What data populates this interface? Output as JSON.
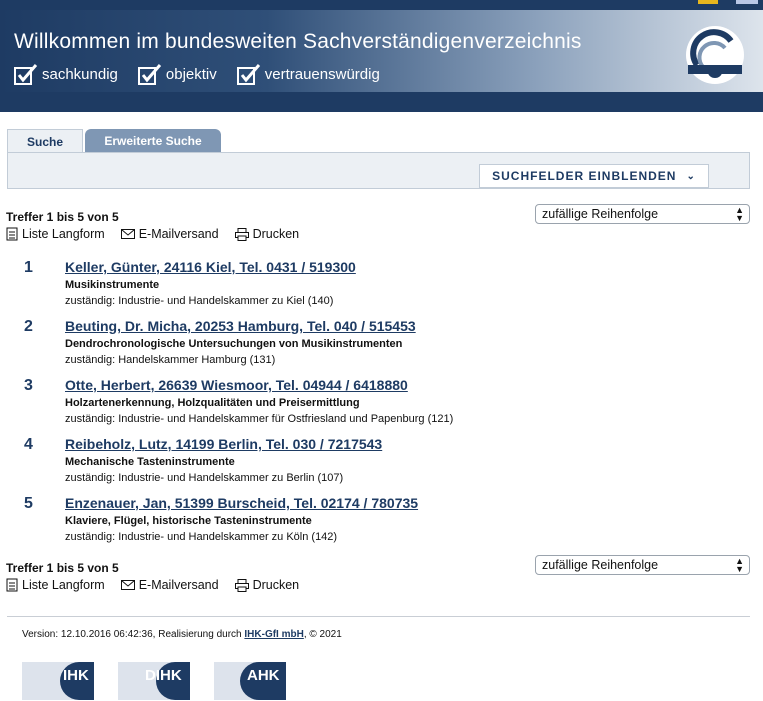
{
  "header": {
    "welcome": "Willkommen im bundesweiten Sachverständigenverzeichnis",
    "claims": [
      "sachkundig",
      "objektiv",
      "vertrauenswürdig"
    ]
  },
  "tabs": [
    {
      "label": "Suche",
      "active": true
    },
    {
      "label": "Erweiterte Suche",
      "active": false
    }
  ],
  "search": {
    "toggle_label": "SUCHFELDER EINBLENDEN"
  },
  "results_top": {
    "count_text": "Treffer 1 bis 5 von 5",
    "actions": [
      "Liste Langform",
      "E-Mailversand",
      "Drucken"
    ],
    "sort_value": "zufällige Reihenfolge"
  },
  "results": [
    {
      "num": "1",
      "title": "Keller, Günter, 24116 Kiel, Tel. 0431 / 519300",
      "subject": "Musikinstrumente",
      "zustaendig": "zuständig: Industrie- und Handelskammer zu Kiel (140)"
    },
    {
      "num": "2",
      "title": "Beuting, Dr. Micha, 20253 Hamburg, Tel. 040 / 515453",
      "subject": "Dendrochronologische Untersuchungen von Musikinstrumenten",
      "zustaendig": "zuständig: Handelskammer Hamburg (131)"
    },
    {
      "num": "3",
      "title": "Otte, Herbert, 26639 Wiesmoor, Tel. 04944 / 6418880",
      "subject": "Holzartenerkennung, Holzqualitäten und Preisermittlung",
      "zustaendig": "zuständig: Industrie- und Handelskammer für Ostfriesland und Papenburg (121)"
    },
    {
      "num": "4",
      "title": "Reibeholz, Lutz, 14199 Berlin, Tel. 030 / 7217543",
      "subject": "Mechanische Tasteninstrumente",
      "zustaendig": "zuständig: Industrie- und Handelskammer zu Berlin (107)"
    },
    {
      "num": "5",
      "title": "Enzenauer, Jan, 51399 Burscheid, Tel. 02174 / 780735",
      "subject": "Klaviere, Flügel, historische Tasteninstrumente",
      "zustaendig": "zuständig: Industrie- und Handelskammer zu Köln (142)"
    }
  ],
  "results_bottom": {
    "count_text": "Treffer 1 bis 5 von 5",
    "actions": [
      "Liste Langform",
      "E-Mailversand",
      "Drucken"
    ],
    "sort_value": "zufällige Reihenfolge"
  },
  "footer": {
    "version_text": "Version: 12.10.2016 06:42:36, Realisierung durch ",
    "company": "IHK-GfI mbH",
    "copyright": ", © 2021",
    "logos": [
      "IHK",
      "DIHK",
      "AHK"
    ]
  },
  "colors": {
    "brand_navy": "#1e3b63",
    "tab_inactive": "#7f97b4",
    "panel": "#ecf0f4"
  }
}
